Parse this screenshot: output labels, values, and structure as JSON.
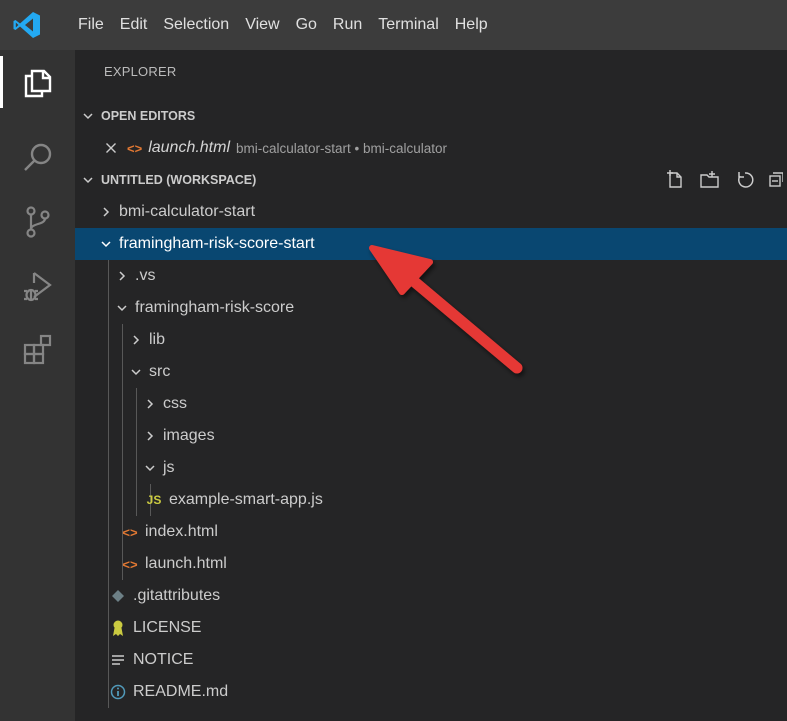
{
  "menubar": {
    "items": [
      "File",
      "Edit",
      "Selection",
      "View",
      "Go",
      "Run",
      "Terminal",
      "Help"
    ]
  },
  "activitybar": {
    "icons": [
      "files-icon",
      "search-icon",
      "source-control-icon",
      "run-debug-icon",
      "extensions-icon"
    ]
  },
  "explorer": {
    "title": "EXPLORER",
    "open_editors": {
      "label": "OPEN EDITORS",
      "items": [
        {
          "name": "launch.html",
          "description": "bmi-calculator-start • bmi-calculator"
        }
      ]
    },
    "workspace": {
      "label": "UNTITLED (WORKSPACE)",
      "tree": [
        {
          "label": "bmi-calculator-start",
          "type": "folder",
          "expanded": false,
          "depth": 0
        },
        {
          "label": "framingham-risk-score-start",
          "type": "folder",
          "expanded": true,
          "depth": 0,
          "selected": true
        },
        {
          "label": ".vs",
          "type": "folder",
          "expanded": false,
          "depth": 1
        },
        {
          "label": "framingham-risk-score",
          "type": "folder",
          "expanded": true,
          "depth": 1
        },
        {
          "label": "lib",
          "type": "folder",
          "expanded": false,
          "depth": 2
        },
        {
          "label": "src",
          "type": "folder",
          "expanded": true,
          "depth": 2
        },
        {
          "label": "css",
          "type": "folder",
          "expanded": false,
          "depth": 3
        },
        {
          "label": "images",
          "type": "folder",
          "expanded": false,
          "depth": 3
        },
        {
          "label": "js",
          "type": "folder",
          "expanded": true,
          "depth": 3
        },
        {
          "label": "example-smart-app.js",
          "type": "file",
          "icon": "js",
          "depth": 4
        },
        {
          "label": "index.html",
          "type": "file",
          "icon": "html",
          "depth": 2
        },
        {
          "label": "launch.html",
          "type": "file",
          "icon": "html",
          "depth": 2
        },
        {
          "label": ".gitattributes",
          "type": "file",
          "icon": "git",
          "depth": 1
        },
        {
          "label": "LICENSE",
          "type": "file",
          "icon": "license",
          "depth": 1
        },
        {
          "label": "NOTICE",
          "type": "file",
          "icon": "text",
          "depth": 1
        },
        {
          "label": "README.md",
          "type": "file",
          "icon": "info",
          "depth": 1
        }
      ]
    }
  },
  "icon_glyphs": {
    "js": "JS",
    "html": "<>"
  },
  "colors": {
    "menubar": "#3c3c3c",
    "activitybar": "#333333",
    "sidebar": "#252526",
    "selection": "#094771",
    "accent_arrow": "#e53935",
    "js_icon": "#cbcb41",
    "html_icon": "#e37933",
    "vscode_blue": "#23a9f2"
  }
}
